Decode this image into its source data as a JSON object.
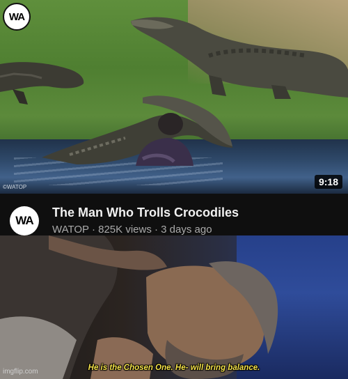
{
  "thumbnail": {
    "logo_text": "WA",
    "watermark": "©WATOP",
    "duration": "9:18"
  },
  "video": {
    "channel_avatar_text": "WA",
    "title": "The Man Who Trolls Crocodiles",
    "meta": "WATOP · 825K views · 3 days ago"
  },
  "movie_still": {
    "subtitle": "He is the Chosen One. He- will bring balance."
  },
  "footer": {
    "watermark": "imgflip.com"
  },
  "colors": {
    "info_bar_bg": "#0f0f0f",
    "title_text": "#f1f1f1",
    "meta_text": "#aaaaaa",
    "subtitle_text": "#f4e24a"
  }
}
